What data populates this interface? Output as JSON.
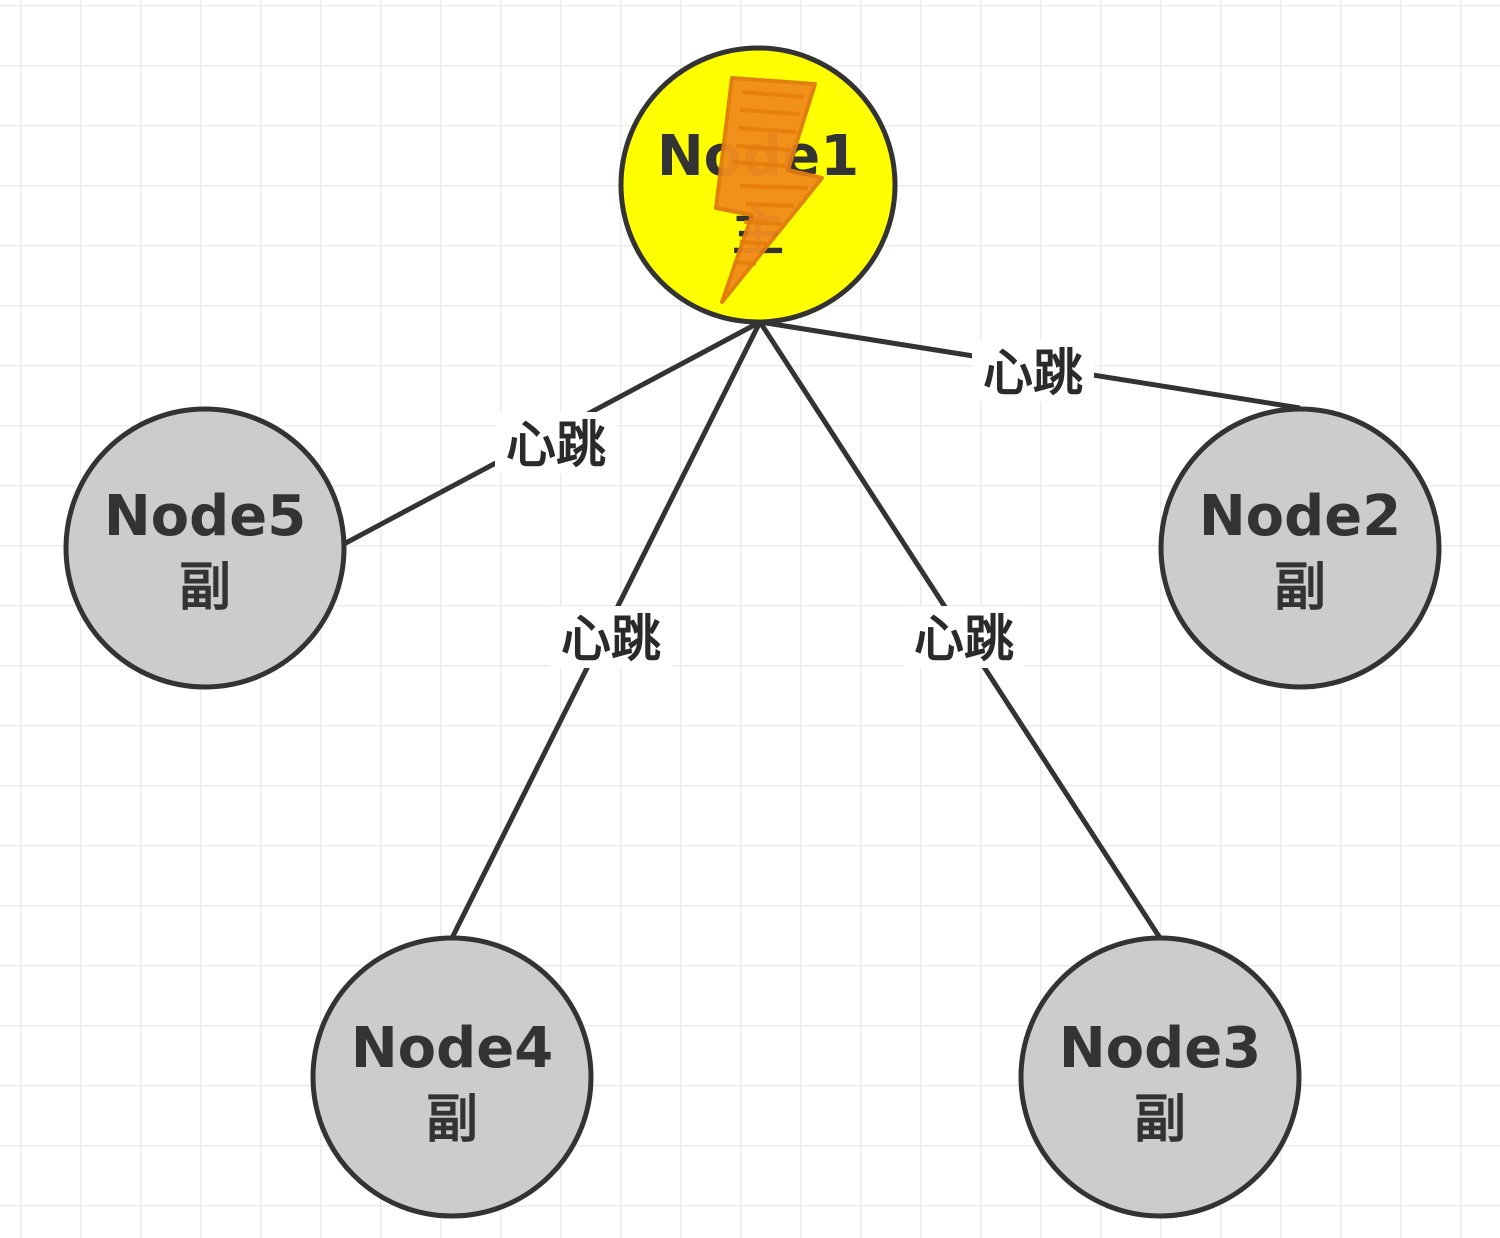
{
  "colors": {
    "primary_fill": "#ffff00",
    "replica_fill": "#cccccc",
    "stroke": "#333333",
    "lightning_fill": "#f28c1c",
    "grid_line": "#eaeaea"
  },
  "nodes": {
    "node1": {
      "title": "Node1",
      "role": "主",
      "status": "primary",
      "icon": "lightning-icon"
    },
    "node2": {
      "title": "Node2",
      "role": "副",
      "status": "replica"
    },
    "node3": {
      "title": "Node3",
      "role": "副",
      "status": "replica"
    },
    "node4": {
      "title": "Node4",
      "role": "副",
      "status": "replica"
    },
    "node5": {
      "title": "Node5",
      "role": "副",
      "status": "replica"
    }
  },
  "edges": [
    {
      "from": "node1",
      "to": "node2",
      "label": "心跳"
    },
    {
      "from": "node1",
      "to": "node3",
      "label": "心跳"
    },
    {
      "from": "node1",
      "to": "node4",
      "label": "心跳"
    },
    {
      "from": "node1",
      "to": "node5",
      "label": "心跳"
    }
  ]
}
